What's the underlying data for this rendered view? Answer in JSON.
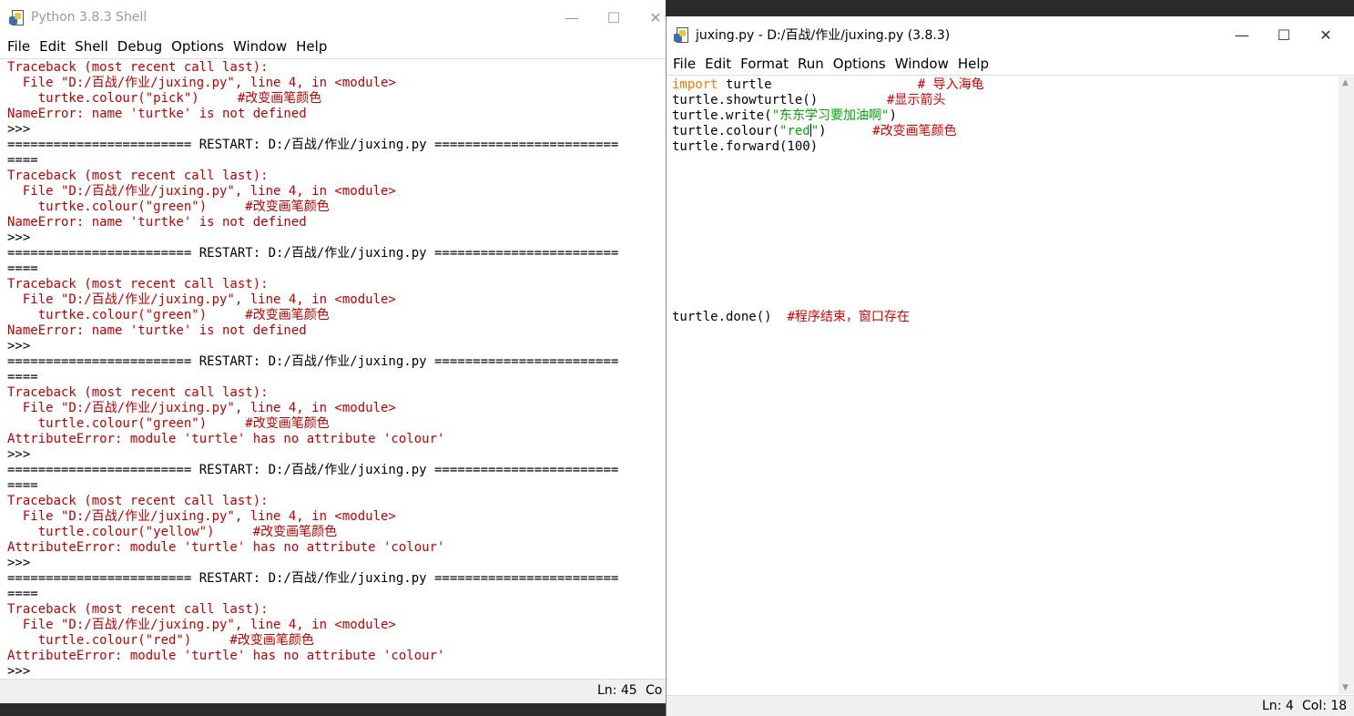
{
  "shell": {
    "title": "Python 3.8.3 Shell",
    "menu": [
      "File",
      "Edit",
      "Shell",
      "Debug",
      "Options",
      "Window",
      "Help"
    ],
    "lines": [
      {
        "t": "Traceback (most recent call last):",
        "c": "err"
      },
      {
        "t": "  File \"D:/百战/作业/juxing.py\", line 4, in <module>",
        "c": "err"
      },
      {
        "t": "    turtke.colour(\"pick\")     #改变画笔颜色",
        "c": "err"
      },
      {
        "t": "NameError: name 'turtke' is not defined",
        "c": "err"
      },
      {
        "t": ">>> ",
        "c": "blk"
      },
      {
        "t": "======================== RESTART: D:/百战/作业/juxing.py ========================",
        "c": "blk"
      },
      {
        "t": "====",
        "c": "blk"
      },
      {
        "t": "Traceback (most recent call last):",
        "c": "err"
      },
      {
        "t": "  File \"D:/百战/作业/juxing.py\", line 4, in <module>",
        "c": "err"
      },
      {
        "t": "    turtke.colour(\"green\")     #改变画笔颜色",
        "c": "err"
      },
      {
        "t": "NameError: name 'turtke' is not defined",
        "c": "err"
      },
      {
        "t": ">>> ",
        "c": "blk"
      },
      {
        "t": "======================== RESTART: D:/百战/作业/juxing.py ========================",
        "c": "blk"
      },
      {
        "t": "====",
        "c": "blk"
      },
      {
        "t": "Traceback (most recent call last):",
        "c": "err"
      },
      {
        "t": "  File \"D:/百战/作业/juxing.py\", line 4, in <module>",
        "c": "err"
      },
      {
        "t": "    turtke.colour(\"green\")     #改变画笔颜色",
        "c": "err"
      },
      {
        "t": "NameError: name 'turtke' is not defined",
        "c": "err"
      },
      {
        "t": ">>> ",
        "c": "blk"
      },
      {
        "t": "======================== RESTART: D:/百战/作业/juxing.py ========================",
        "c": "blk"
      },
      {
        "t": "====",
        "c": "blk"
      },
      {
        "t": "Traceback (most recent call last):",
        "c": "err"
      },
      {
        "t": "  File \"D:/百战/作业/juxing.py\", line 4, in <module>",
        "c": "err"
      },
      {
        "t": "    turtle.colour(\"green\")     #改变画笔颜色",
        "c": "err"
      },
      {
        "t": "AttributeError: module 'turtle' has no attribute 'colour'",
        "c": "err"
      },
      {
        "t": ">>> ",
        "c": "blk"
      },
      {
        "t": "======================== RESTART: D:/百战/作业/juxing.py ========================",
        "c": "blk"
      },
      {
        "t": "====",
        "c": "blk"
      },
      {
        "t": "Traceback (most recent call last):",
        "c": "err"
      },
      {
        "t": "  File \"D:/百战/作业/juxing.py\", line 4, in <module>",
        "c": "err"
      },
      {
        "t": "    turtle.colour(\"yellow\")     #改变画笔颜色",
        "c": "err"
      },
      {
        "t": "AttributeError: module 'turtle' has no attribute 'colour'",
        "c": "err"
      },
      {
        "t": ">>> ",
        "c": "blk"
      },
      {
        "t": "======================== RESTART: D:/百战/作业/juxing.py ========================",
        "c": "blk"
      },
      {
        "t": "====",
        "c": "blk"
      },
      {
        "t": "Traceback (most recent call last):",
        "c": "err"
      },
      {
        "t": "  File \"D:/百战/作业/juxing.py\", line 4, in <module>",
        "c": "err"
      },
      {
        "t": "    turtle.colour(\"red\")     #改变画笔颜色",
        "c": "err"
      },
      {
        "t": "AttributeError: module 'turtle' has no attribute 'colour'",
        "c": "err"
      },
      {
        "t": ">>> ",
        "c": "blk"
      }
    ],
    "status": {
      "ln": "Ln: 45",
      "col": "Co"
    }
  },
  "editor": {
    "title": "juxing.py - D:/百战/作业/juxing.py (3.8.3)",
    "menu": [
      "File",
      "Edit",
      "Format",
      "Run",
      "Options",
      "Window",
      "Help"
    ],
    "lines": [
      [
        {
          "t": "import",
          "c": "kw"
        },
        {
          "t": " turtle                   ",
          "c": "blk"
        },
        {
          "t": "# 导入海龟",
          "c": "cmt"
        }
      ],
      [
        {
          "t": "turtle.showturtle()         ",
          "c": "blk"
        },
        {
          "t": "#显示箭头",
          "c": "cmt"
        }
      ],
      [
        {
          "t": "turtle.write(",
          "c": "blk"
        },
        {
          "t": "\"东东学习要加油啊\"",
          "c": "str"
        },
        {
          "t": ")",
          "c": "blk"
        }
      ],
      [
        {
          "t": "turtle.colour(",
          "c": "blk"
        },
        {
          "t": "\"red",
          "c": "str"
        },
        {
          "t": "|cursor|",
          "c": "cursor"
        },
        {
          "t": "\"",
          "c": "str"
        },
        {
          "t": ")      ",
          "c": "blk"
        },
        {
          "t": "#改变画笔颜色",
          "c": "cmt"
        }
      ],
      [
        {
          "t": "turtle.forward(100)",
          "c": "blk"
        }
      ],
      [],
      [],
      [],
      [],
      [],
      [],
      [],
      [],
      [],
      [],
      [
        {
          "t": "turtle.done()  ",
          "c": "blk"
        },
        {
          "t": "#程序结束，窗口存在",
          "c": "cmt"
        }
      ]
    ],
    "status": {
      "ln": "Ln: 4",
      "col": "Col: 18"
    }
  }
}
